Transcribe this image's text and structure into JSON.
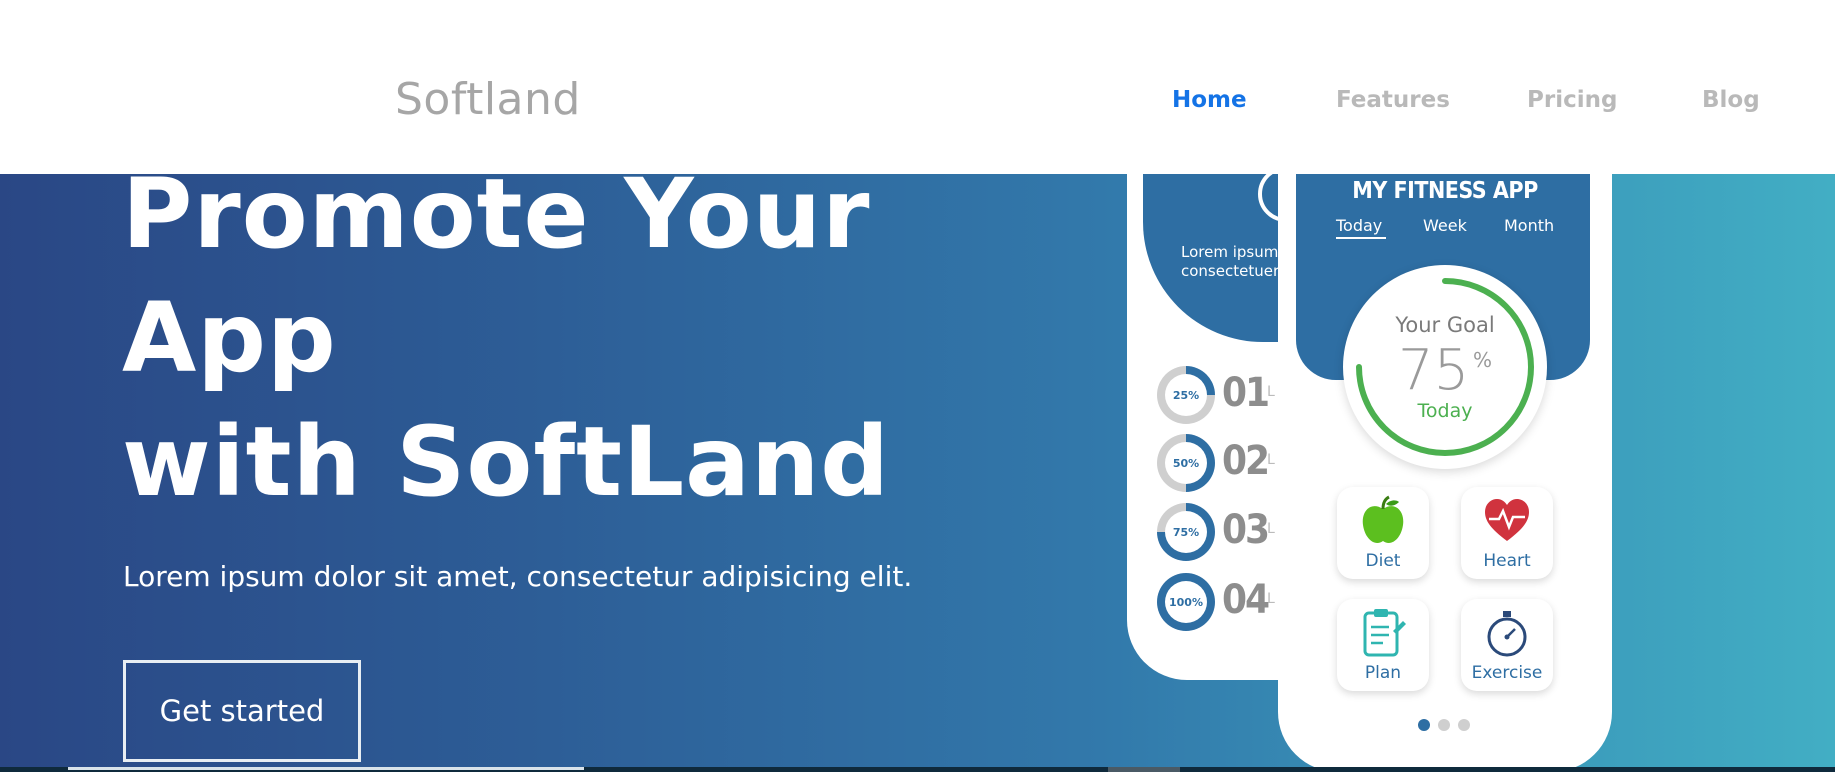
{
  "header": {
    "logo": "Softland",
    "nav": [
      {
        "label": "Home",
        "active": true
      },
      {
        "label": "Features",
        "active": false
      },
      {
        "label": "Pricing",
        "active": false
      },
      {
        "label": "Blog",
        "active": false
      }
    ]
  },
  "hero": {
    "headline_lines": [
      "Promote Your",
      "App",
      "with SoftLand"
    ],
    "subtext": "Lorem ipsum dolor sit amet, consectetur adipisicing elit.",
    "cta_label": "Get started"
  },
  "phone_back": {
    "text_lines": [
      "Lorem ipsum",
      "consectetuer"
    ],
    "progress": [
      {
        "pct_label": "25%",
        "number": "01",
        "text": "L",
        "fraction": 0.25
      },
      {
        "pct_label": "50%",
        "number": "02",
        "text": "L",
        "fraction": 0.5
      },
      {
        "pct_label": "75%",
        "number": "03",
        "text": "L",
        "fraction": 0.75
      },
      {
        "pct_label": "100%",
        "number": "04",
        "text": "L",
        "fraction": 1.0
      }
    ]
  },
  "phone_front": {
    "app_title": "MY FITNESS APP",
    "tabs": [
      "Today",
      "Week",
      "Month"
    ],
    "goal": {
      "label": "Your Goal",
      "value": "75",
      "unit": "%",
      "sub": "Today",
      "fraction": 0.75
    },
    "tiles": [
      "Diet",
      "Heart",
      "Plan",
      "Exercise"
    ],
    "pager_dots": 3,
    "active_dot": 0
  },
  "colors": {
    "accent": "#1473e6",
    "app_blue": "#2e6ea3",
    "goal_green": "#4cb050",
    "ring_gray": "#cfcfcf"
  }
}
